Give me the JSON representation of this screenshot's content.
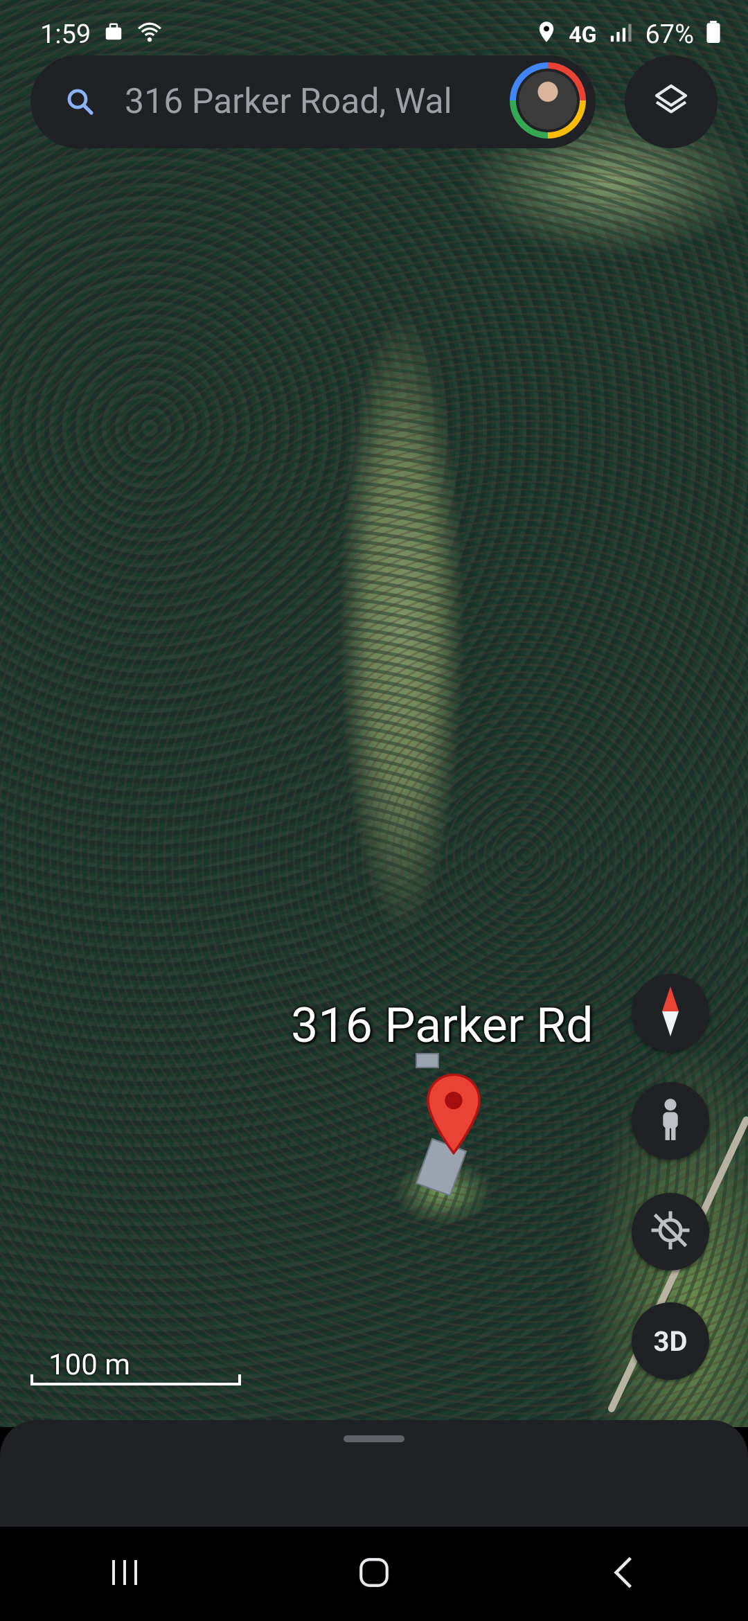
{
  "status_bar": {
    "time": "1:59",
    "network": "4G",
    "battery": "67%",
    "icons": [
      "briefcase-icon",
      "wifi-icon",
      "location-icon",
      "signal-icon",
      "battery-icon"
    ]
  },
  "search": {
    "text": "316 Parker Road, Wal",
    "icon": "search-icon"
  },
  "map": {
    "place_label": "316 Parker Rd",
    "scale_label": "100 m",
    "view": "satellite"
  },
  "controls": {
    "compass": "compass-icon",
    "street_view": "pegman-icon",
    "location": "my-location-icon",
    "three_d_label": "3D",
    "layers": "layers-icon"
  },
  "nav": {
    "recents": "recents-icon",
    "home": "home-icon",
    "back": "back-icon"
  },
  "colors": {
    "pin": "#ea4335",
    "surface": "#202124"
  }
}
